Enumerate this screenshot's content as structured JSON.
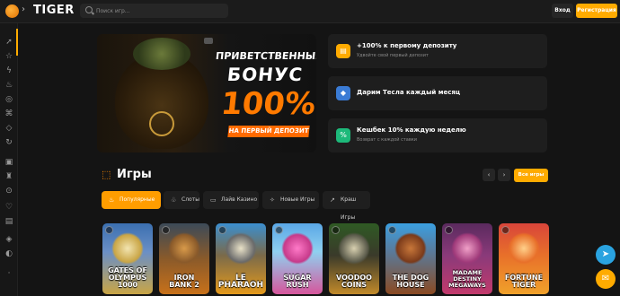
{
  "header": {
    "logo_text": "TIGER",
    "search_placeholder": "Поиск игр...",
    "login_label": "Вход",
    "register_label": "Регистрация"
  },
  "sidebar": {
    "icons": [
      "rocket-icon",
      "star-icon",
      "lightning-icon",
      "fire-icon",
      "chip-icon",
      "gamepad-icon",
      "diamond-icon",
      "cycle-icon",
      "shop-icon",
      "trophy-icon",
      "heart-icon",
      "gift-icon",
      "headset-icon",
      "support-icon",
      "exit-icon"
    ]
  },
  "hero": {
    "line1": "ПРИВЕТСТВЕННЫЙ",
    "line2": "БОНУС",
    "line3": "100%",
    "line4": "НА ПЕРВЫЙ ДЕПОЗИТ",
    "slides": 3,
    "active_slide": 1
  },
  "promos": [
    {
      "title": "+100% к первому депозиту",
      "subtitle": "Удвойте свой первый депозит",
      "icon": "gift-icon",
      "color": "#ffab00"
    },
    {
      "title": "Дарим Тесла каждый месяц",
      "subtitle": "",
      "icon": "car-icon",
      "color": "#3a7bd5"
    },
    {
      "title": "Кешбек 10% каждую неделю",
      "subtitle": "Возврат с каждой ставки",
      "icon": "percent-icon",
      "color": "#1db97a"
    }
  ],
  "games_section": {
    "title": "Игры",
    "all_label": "Все игры",
    "prev_icon": "chevron-left-icon",
    "next_icon": "chevron-right-icon"
  },
  "tabs": [
    {
      "label": "Популярные",
      "icon": "fire-icon",
      "active": true
    },
    {
      "label": "Слоты",
      "icon": "slot-icon",
      "active": false
    },
    {
      "label": "Лайв Казино",
      "icon": "camera-icon",
      "active": false
    },
    {
      "label": "Новые Игры",
      "icon": "sparkle-icon",
      "active": false
    },
    {
      "label": "Краш Игры",
      "icon": "crash-icon",
      "active": false
    }
  ],
  "games": [
    {
      "name": "GATES OF OLYMPUS 1000",
      "line1": "GATES OF",
      "line2": "OLYMPUS",
      "line3": "1000",
      "bg": "#3b6fb0",
      "bg2": "#c9a545"
    },
    {
      "name": "IRON BANK 2",
      "line1": "",
      "line2": "IRON",
      "line3": "BANK 2",
      "bg": "#c8711a",
      "bg2": "#3c4a58"
    },
    {
      "name": "LE PHARAOH",
      "line1": "",
      "line2": "LE",
      "line3": "PHARAOH",
      "bg": "#e59a1c",
      "bg2": "#3b8fcf"
    },
    {
      "name": "SUGAR RUSH",
      "line1": "",
      "line2": "SUGAR",
      "line3": "RUSH",
      "bg": "#5aa7e6",
      "bg2": "#d6569c"
    },
    {
      "name": "VOODOO COINS",
      "line1": "",
      "line2": "VOODOO",
      "line3": "COINS",
      "bg": "#2f5a24",
      "bg2": "#c28a2a"
    },
    {
      "name": "THE DOG HOUSE",
      "line1": "",
      "line2": "THE DOG",
      "line3": "HOUSE",
      "bg": "#3a9fe0",
      "bg2": "#8a4a22"
    },
    {
      "name": "MADAME DESTINY MEGAWAYS",
      "line1": "MADAME",
      "line2": "DESTINY",
      "line3": "MEGAWAYS",
      "bg": "#5a2a5e",
      "bg2": "#c23a6c"
    },
    {
      "name": "FORTUNE TIGER",
      "line1": "",
      "line2": "FORTUNE",
      "line3": "TIGER",
      "bg": "#d8453a",
      "bg2": "#f0a12a"
    }
  ],
  "floating": {
    "telegram_icon": "telegram-icon",
    "chat_icon": "chat-icon"
  }
}
